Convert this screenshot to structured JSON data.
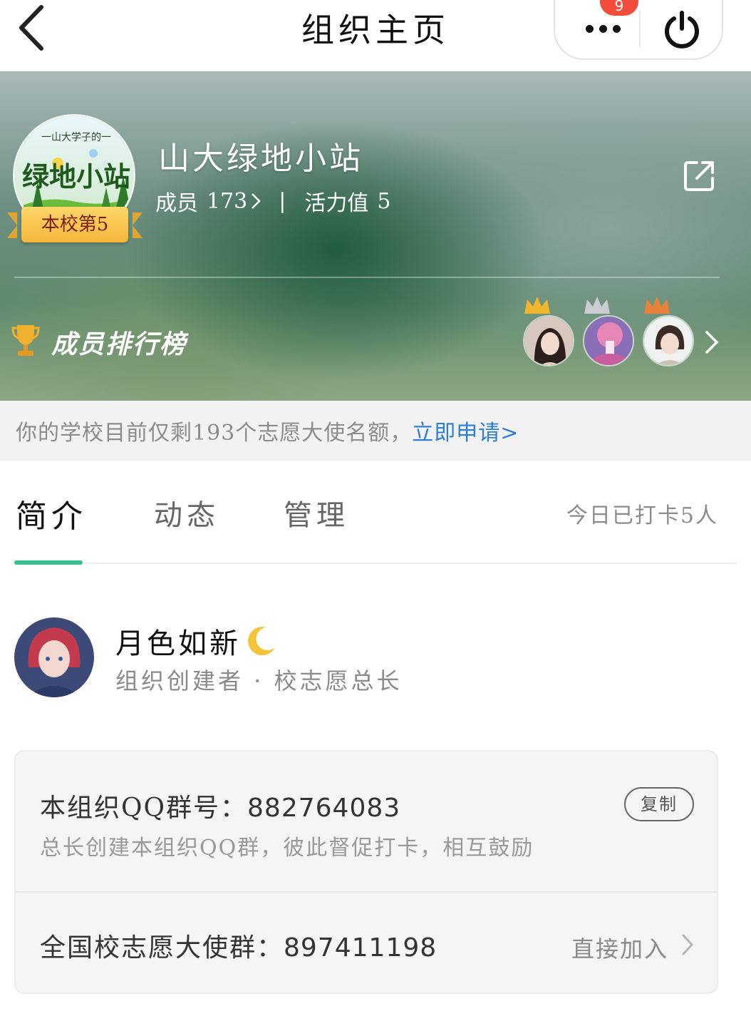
{
  "nav": {
    "title": "组织主页",
    "badge_count": "9"
  },
  "org": {
    "name": "山大绿地小站",
    "logo_caption": "一山大学子的一",
    "logo_big_text": "绿地小站",
    "rank_label": "本校第5",
    "members_label": "成员",
    "members_count": "173",
    "separator": "|",
    "vitality_label": "活力值",
    "vitality_value": "5"
  },
  "ranking": {
    "title": "成员排行榜",
    "crown_colors": [
      "#f0b531",
      "#c9cdd2",
      "#e8823a"
    ]
  },
  "notice": {
    "text": "你的学校目前仅剩193个志愿大使名额，",
    "link": "立即申请>"
  },
  "tabs": {
    "items": [
      {
        "label": "简介"
      },
      {
        "label": "动态"
      },
      {
        "label": "管理"
      }
    ],
    "checkin": "今日已打卡5人"
  },
  "founder": {
    "name": "月色如新",
    "role": "组织创建者 · 校志愿总长"
  },
  "card": {
    "qq_label": "本组织QQ群号：",
    "qq_number": "882764083",
    "qq_desc": "总长创建本组织QQ群，彼此督促打卡，相互鼓励",
    "copy_label": "复制",
    "national_label": "全国校志愿大使群：",
    "national_number": "897411198",
    "join_label": "直接加入"
  },
  "colors": {
    "accent_green": "#39c08e",
    "link_blue": "#2c7fd6",
    "badge_red": "#f24c3d",
    "rank_gold": "#f5b63a"
  }
}
